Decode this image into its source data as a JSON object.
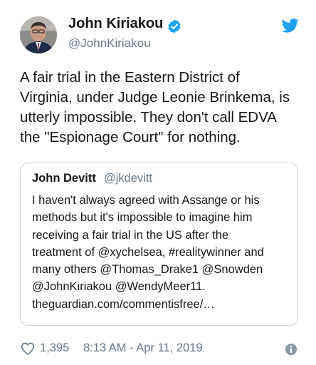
{
  "author": {
    "name": "John Kiriakou",
    "handle": "@JohnKiriakou"
  },
  "tweet": {
    "lines": [
      "A fair trial in the Eastern District of",
      "Virginia, under Judge Leonie Brinkema, is",
      "utterly impossible.  They don't call EDVA",
      "the \"Espionage Court\" for nothing."
    ]
  },
  "quoted": {
    "name": "John Devitt",
    "handle": "@jkdevitt",
    "lines": [
      "I haven't always agreed with Assange or his",
      "methods but it's impossible to imagine him",
      "receiving a fair trial in the US after the",
      "treatment of @xychelsea, #realitywinner and",
      "many others @Thomas_Drake1 @Snowden",
      "@JohnKiriakou @WendyMeer11.",
      "theguardian.com/commentisfree/…"
    ]
  },
  "footer": {
    "likes": "1,395",
    "timestamp": "8:13 AM - Apr 11, 2019"
  },
  "colors": {
    "twitter_blue": "#1da1f2",
    "secondary_text": "#657786",
    "border": "#ccd6dd"
  },
  "icons": {
    "verified": "verified-badge-icon",
    "brand": "twitter-bird-icon",
    "like": "heart-icon",
    "info": "info-icon"
  }
}
